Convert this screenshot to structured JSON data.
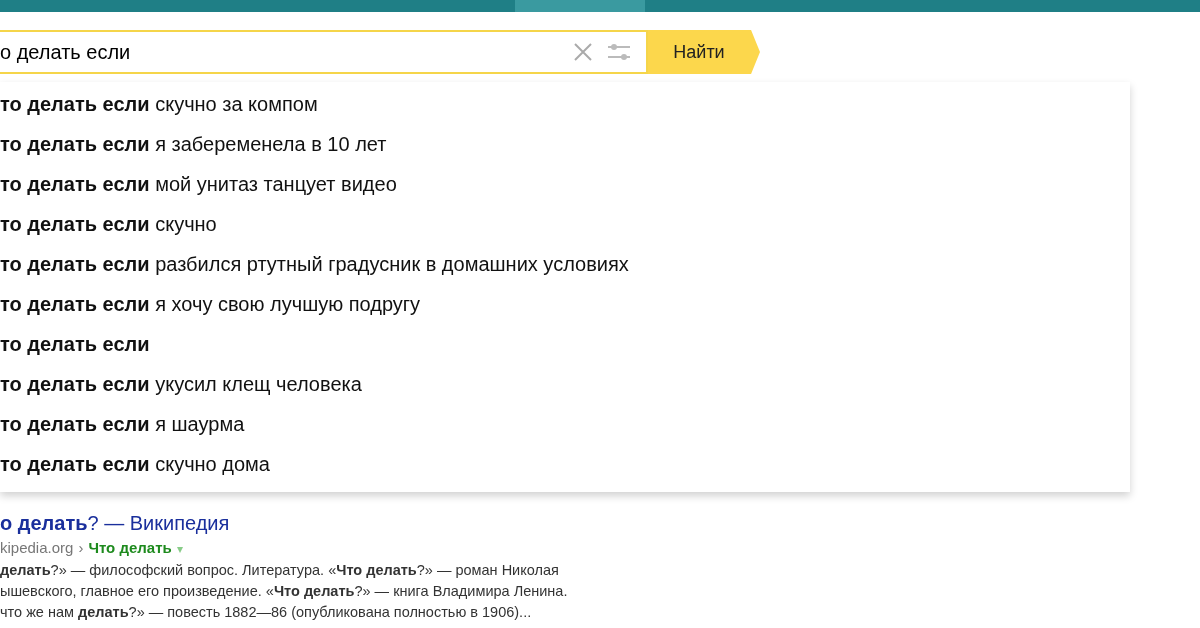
{
  "search": {
    "value": "о делать если",
    "button": "Найти"
  },
  "suggestions": [
    "**то делать если** скучно за компом",
    "**то делать если** я забеременела в 10 лет",
    "**то делать если** мой унитаз танцует видео",
    "**то делать если** скучно",
    "**то делать если** разбился ртутный градусник в домашних условиях",
    "**то делать если** я хочу свою лучшую подругу",
    "**то делать если**",
    "**то делать если** укусил клещ человека",
    "**то делать если** я шаурма",
    "**то делать если** скучно дома"
  ],
  "result": {
    "title": "**о делать**? — Википедия",
    "domain": "kipedia.org",
    "separator": "›",
    "path": "Что делать",
    "menu": "▾",
    "snippet": [
      "**делать**?» — философский вопрос. Литература. «**Что делать**?» — роман Николая",
      "ышевского, главное его произведение. «**Что делать**?» — книга Владимира Ленина.",
      "что же нам **делать**?» — повесть 1882—86 (опубликована полностью в 1906)..."
    ]
  }
}
